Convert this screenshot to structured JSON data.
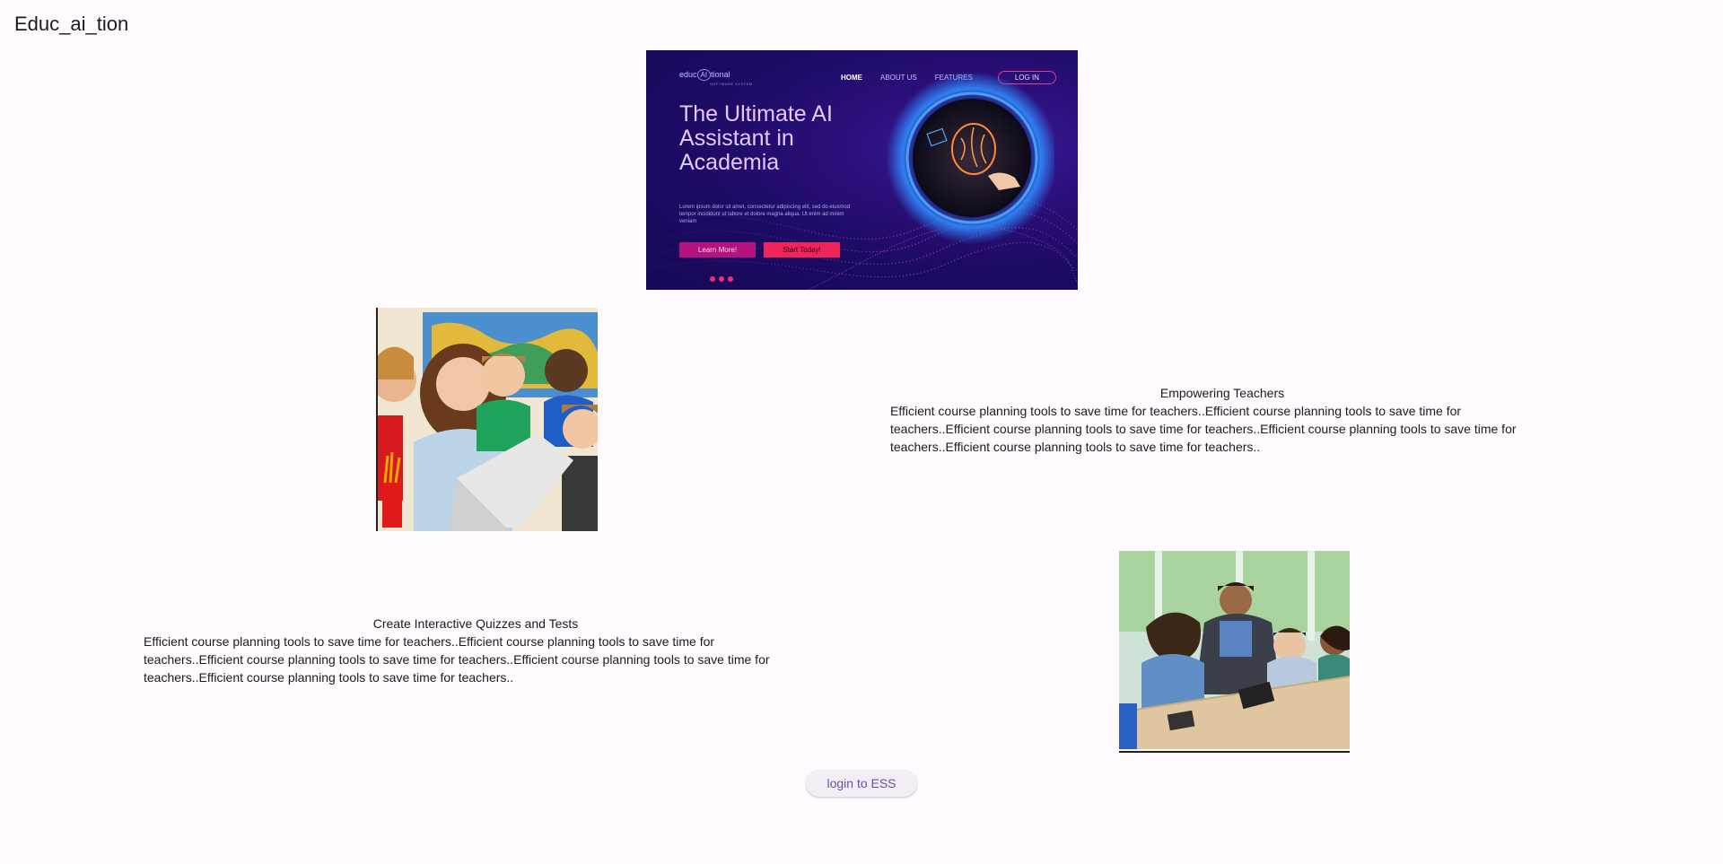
{
  "app": {
    "title": "Educ_ai_tion"
  },
  "hero": {
    "logo_prefix": "educ",
    "logo_ai": "AI",
    "logo_suffix": "tional",
    "logo_sub": "SOFTWARE SYSTEM",
    "nav": [
      "HOME",
      "ABOUT US",
      "FEATURES",
      "LOG IN"
    ],
    "headline": "The Ultimate AI Assistant in Academia",
    "body": "Lorem ipsum dolor sit amet, consectetur adipiscing elit, sed do eiusmod tempor incididunt ut labore et dolore magna aliqua. Ut enim ad minim veniam",
    "learn_label": "Learn More!",
    "start_label": "Start Today!",
    "colors": {
      "background": "#1d0b63",
      "accent_pink": "#f0245a",
      "accent_magenta": "#b3127f",
      "headline": "#e6c8ff",
      "orb": "#2f8cff"
    }
  },
  "features": [
    {
      "title": "Empowering Teachers",
      "body": "Efficient course planning tools to save time for teachers..Efficient course planning tools to save time for teachers..Efficient course planning tools to save time for teachers..Efficient course planning tools to save time for teachers..Efficient course planning tools to save time for teachers.."
    },
    {
      "title": "Create Interactive Quizzes and Tests",
      "body": "Efficient course planning tools to save time for teachers..Efficient course planning tools to save time for teachers..Efficient course planning tools to save time for teachers..Efficient course planning tools to save time for teachers..Efficient course planning tools to save time for teachers.."
    }
  ],
  "login_button": {
    "label": "login to ESS",
    "color": "#6750a4"
  }
}
